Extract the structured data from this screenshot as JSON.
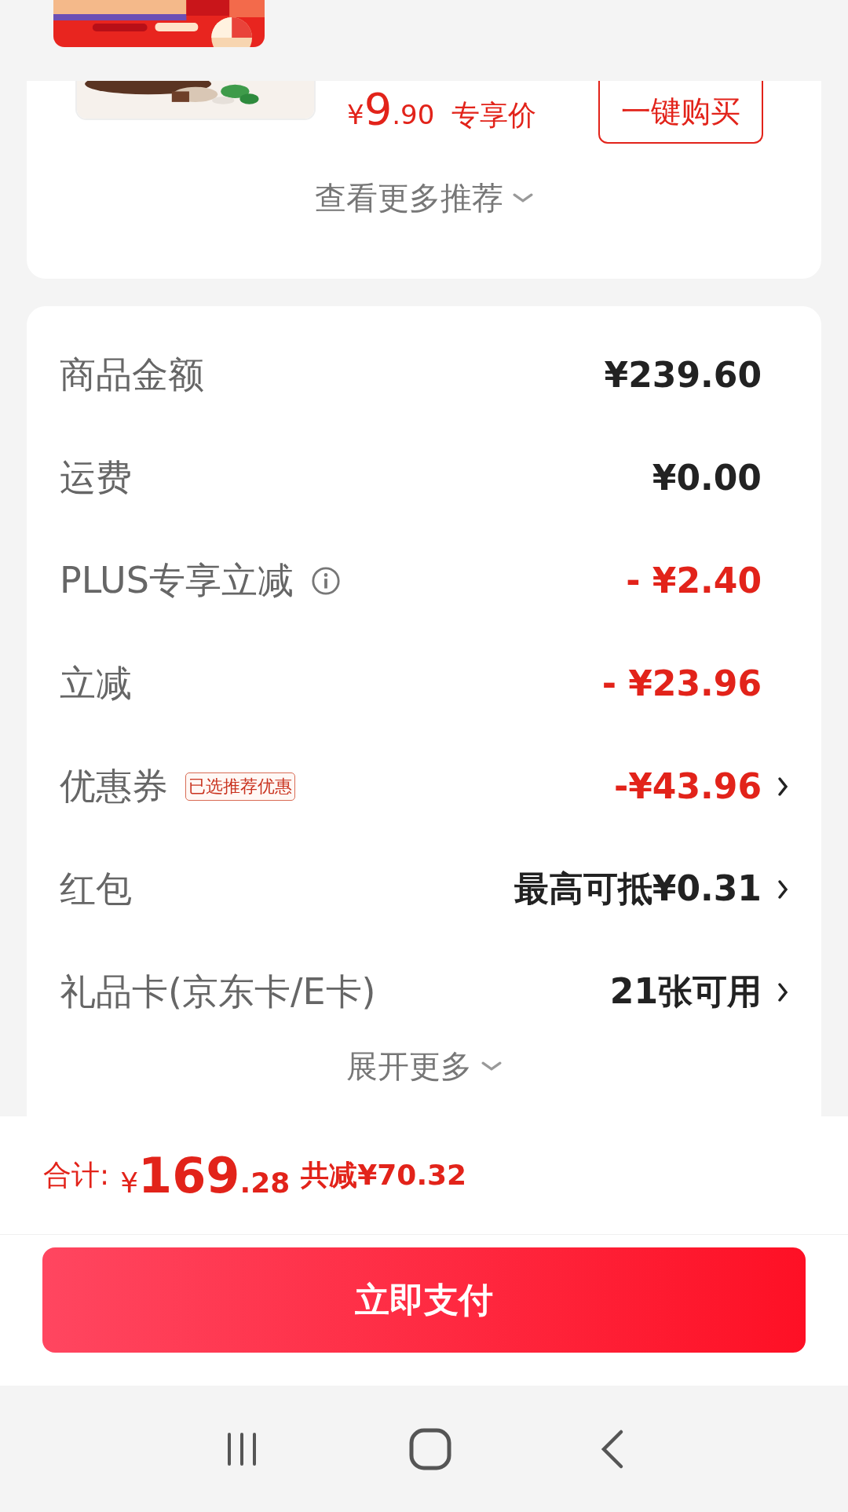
{
  "recommendation": {
    "price_symbol": "¥",
    "price_main": "9",
    "price_decimal": ".90",
    "price_label": "专享价",
    "buy_button": "一键购买",
    "more_link": "查看更多推荐"
  },
  "summary": {
    "rows": [
      {
        "kind": "plain",
        "label": "商品金额",
        "value": "¥239.60",
        "color": "#222222",
        "link": false
      },
      {
        "kind": "plain",
        "label": "运费",
        "value": "¥0.00",
        "color": "#222222",
        "link": false
      },
      {
        "kind": "info",
        "label": "PLUS专享立减",
        "value": "- ¥2.40",
        "color": "#e2231a",
        "link": false
      },
      {
        "kind": "plain",
        "label": "立减",
        "value": "- ¥23.96",
        "color": "#e2231a",
        "link": false
      },
      {
        "kind": "tag",
        "label": "优惠券",
        "tag": "已选推荐优惠",
        "value": "-¥43.96",
        "color": "#e2231a",
        "link": true
      },
      {
        "kind": "plain",
        "label": "红包",
        "value": "最高可抵¥0.31",
        "color": "#222222",
        "link": true
      },
      {
        "kind": "plain",
        "label": "礼品卡(京东卡/E卡)",
        "value": "21张可用",
        "color": "#222222",
        "link": true
      }
    ],
    "expand": "展开更多"
  },
  "footer": {
    "total_label": "合计:",
    "total_symbol": "¥",
    "total_main": "169",
    "total_decimal": ".28",
    "saved": "共减¥70.32",
    "pay_button": "立即支付"
  }
}
